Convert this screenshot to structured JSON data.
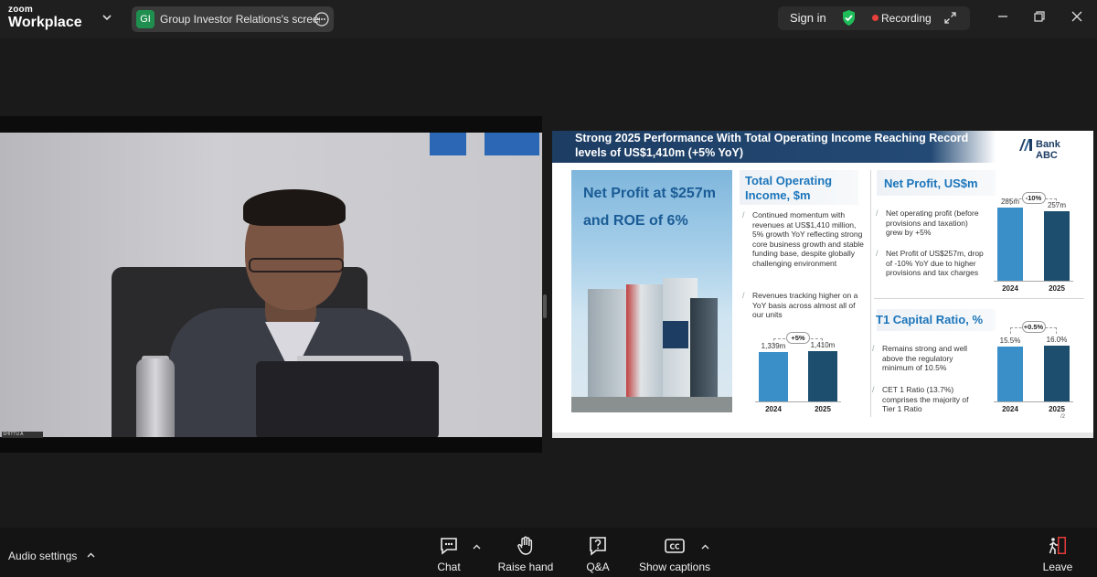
{
  "topbar": {
    "brand_small": "zoom",
    "brand_large": "Workplace",
    "share_badge": "GI",
    "share_label": "Group Investor Relations's screen",
    "signin": "Sign in",
    "recording": "Recording"
  },
  "video": {
    "participant_name": "SHITTU A Alexandria"
  },
  "slide": {
    "title": "Strong 2025 Performance With Total Operating Income Reaching Record levels of US$1,410m (+5% YoY)",
    "logo_text": "Bank ABC",
    "hero_text": "Net Profit at $257m and ROE of 6%",
    "toi": {
      "title": "Total Operating Income, $m",
      "bullets": [
        "Continued momentum with revenues at US$1,410 million, 5% growth YoY reflecting strong core business growth and stable funding base, despite globally challenging environment",
        "Revenues tracking higher on a YoY basis across almost all of our units"
      ],
      "delta": "+5%",
      "bars": [
        {
          "label": "1,339m",
          "year": "2024",
          "value": 1339
        },
        {
          "label": "1,410m",
          "year": "2025",
          "value": 1410
        }
      ]
    },
    "np": {
      "title": "Net Profit, US$m",
      "bullets": [
        "Net operating profit (before provisions and taxation) grew by +5%",
        "Net Profit of US$257m, drop of -10% YoY due to higher provisions and tax charges"
      ],
      "delta": "-10%",
      "bars": [
        {
          "label": "285m",
          "year": "2024",
          "value": 285
        },
        {
          "label": "257m",
          "year": "2025",
          "value": 257
        }
      ]
    },
    "t1": {
      "title": "T1 Capital Ratio, %",
      "bullets": [
        "Remains strong and well above the regulatory minimum of 10.5%",
        "CET 1 Ratio (13.7%) comprises the majority of Tier 1 Ratio"
      ],
      "delta": "+0.5%",
      "bars": [
        {
          "label": "15.5%",
          "year": "2024",
          "value": 15.5
        },
        {
          "label": "16.0%",
          "year": "2025",
          "value": 16.0
        }
      ]
    },
    "page_number": "/2",
    "colors": {
      "bar_light": "#3b8fc9",
      "bar_dark": "#1d4e6e"
    }
  },
  "toolbar": {
    "audio_settings": "Audio settings",
    "chat": "Chat",
    "raise_hand": "Raise hand",
    "qa": "Q&A",
    "show_captions": "Show captions",
    "leave": "Leave"
  }
}
